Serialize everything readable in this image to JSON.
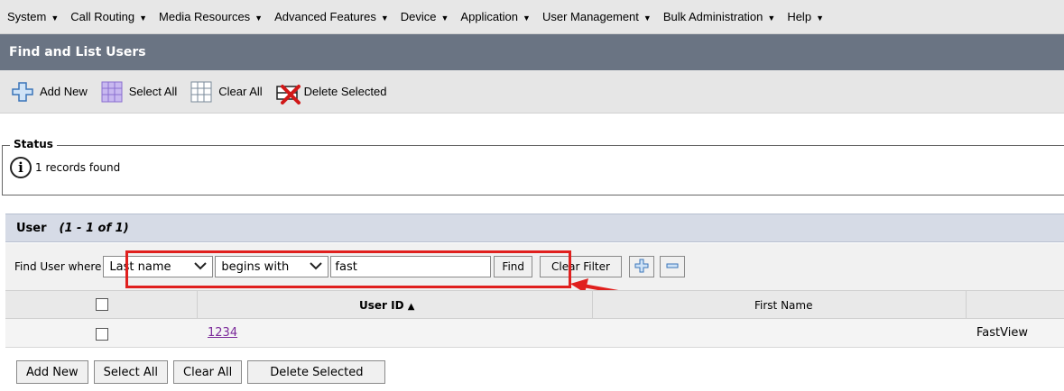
{
  "menu": [
    {
      "label": "System"
    },
    {
      "label": "Call Routing"
    },
    {
      "label": "Media Resources"
    },
    {
      "label": "Advanced Features"
    },
    {
      "label": "Device"
    },
    {
      "label": "Application"
    },
    {
      "label": "User Management"
    },
    {
      "label": "Bulk Administration"
    },
    {
      "label": "Help"
    }
  ],
  "page": {
    "title": "Find and List Users"
  },
  "toolbar": {
    "add_new": "Add New",
    "select_all": "Select All",
    "clear_all": "Clear All",
    "delete_selected": "Delete Selected"
  },
  "status": {
    "legend": "Status",
    "message": "1 records found"
  },
  "user_section": {
    "title": "User",
    "count": "(1 - 1 of 1)"
  },
  "filter": {
    "label": "Find User where",
    "field_selected": "Last name",
    "condition_selected": "begins with",
    "value": "fast",
    "find_button": "Find",
    "clear_filter_button": "Clear Filter"
  },
  "table": {
    "columns": [
      "User ID",
      "First Name"
    ],
    "sort_indicator": "▲",
    "rows": [
      {
        "user_id": "1234",
        "first_name": "FastView"
      }
    ]
  },
  "bottom_buttons": {
    "add_new": "Add New",
    "select_all": "Select All",
    "clear_all": "Clear All",
    "delete_selected": "Delete Selected"
  },
  "colors": {
    "title_bar": "#6a7483",
    "highlight": "#e0201e",
    "link": "#7b2a9a"
  }
}
